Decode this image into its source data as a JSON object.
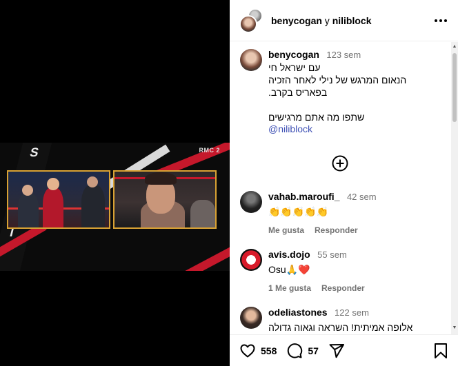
{
  "media": {
    "broadcaster": "RMC 2",
    "pillar_text": "S  I"
  },
  "post": {
    "header": {
      "user1": "benycogan",
      "connector": "y",
      "user2": "niliblock",
      "more_icon": "more-horizontal-icon"
    },
    "caption": {
      "username": "benycogan",
      "time": "123 sem",
      "lines": [
        "עם ישראל חי",
        "הנאום המרגש של נילי לאחר הזכיה",
        "בפאריס בקרב."
      ],
      "line4": "שתפו מה אתם מרגישים",
      "mention": "@niliblock"
    },
    "load_more_icon": "plus-circle-icon",
    "comments": [
      {
        "username": "vahab.maroufi_",
        "time": "42 sem",
        "text": "👏👏👏👏👏",
        "likes_label": "",
        "like_label": "Me gusta",
        "reply_label": "Responder"
      },
      {
        "username": "avis.dojo",
        "time": "55 sem",
        "text": "Osu🙏❤️",
        "likes_label": "1 Me gusta",
        "reply_label": "Responder"
      },
      {
        "username": "odeliastones",
        "time": "122 sem",
        "text": "אלופה אמיתית! השראה וגאוה גדולה"
      }
    ],
    "footer": {
      "likes": "558",
      "comments": "57"
    }
  }
}
